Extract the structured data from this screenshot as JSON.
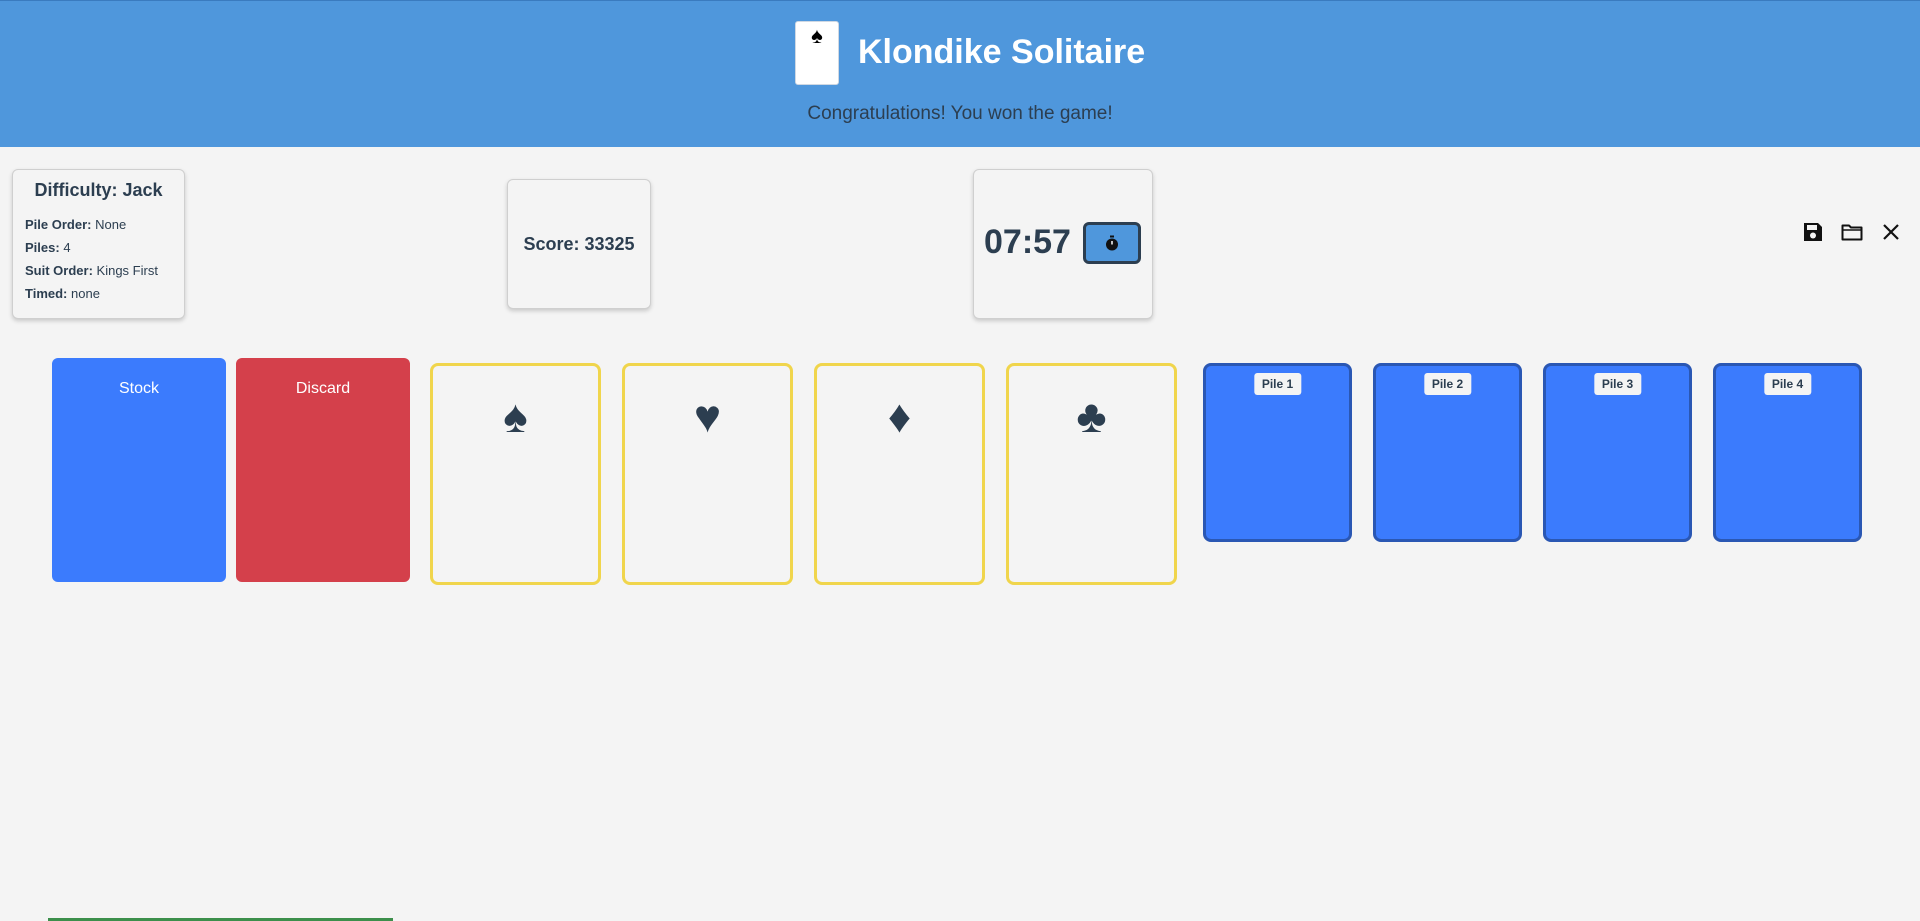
{
  "header": {
    "logo_suit": "♠",
    "title": "Klondike Solitaire",
    "message": "Congratulations! You won the game!"
  },
  "difficulty": {
    "title": "Difficulty: Jack",
    "rows": [
      {
        "label": "Pile Order:",
        "value": "None"
      },
      {
        "label": "Piles:",
        "value": "4"
      },
      {
        "label": "Suit Order:",
        "value": "Kings First"
      },
      {
        "label": "Timed:",
        "value": "none"
      }
    ]
  },
  "score": {
    "text": "Score: 33325"
  },
  "timer": {
    "time": "07:57",
    "button_icon": "stopwatch-icon"
  },
  "toolbar": {
    "icons": [
      "save-icon",
      "folder-icon",
      "close-icon"
    ]
  },
  "board": {
    "stock_label": "Stock",
    "discard_label": "Discard",
    "foundations": [
      {
        "suit": "♠",
        "name": "spades"
      },
      {
        "suit": "♥",
        "name": "hearts"
      },
      {
        "suit": "♦",
        "name": "diamonds"
      },
      {
        "suit": "♣",
        "name": "clubs"
      }
    ],
    "piles": [
      {
        "label": "Pile 1"
      },
      {
        "label": "Pile 2"
      },
      {
        "label": "Pile 3"
      },
      {
        "label": "Pile 4"
      }
    ]
  },
  "colors": {
    "header": "#4f97dc",
    "stock": "#3b7bfd",
    "discard": "#d4404b",
    "foundation_border": "#f0d54c",
    "pile_border": "#2a57b3",
    "text": "#2c3e50"
  }
}
